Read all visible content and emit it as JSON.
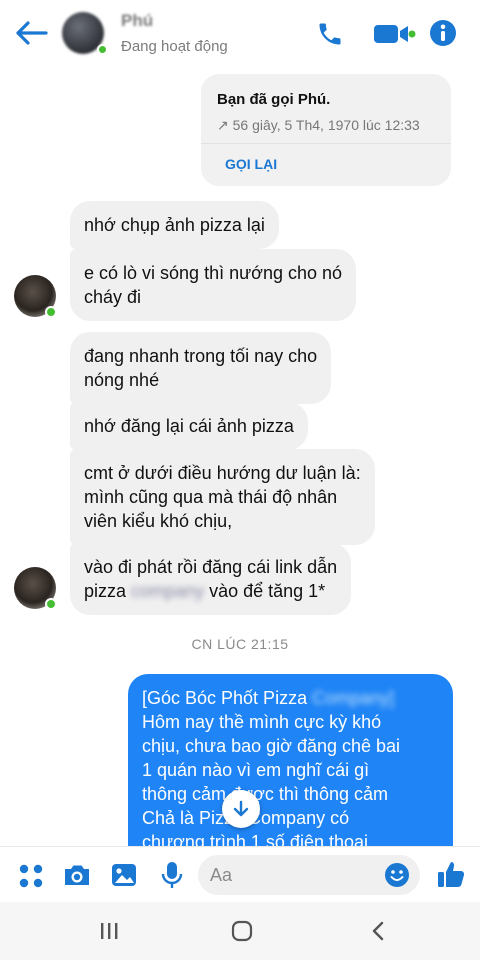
{
  "header": {
    "contact_name": "Phú",
    "status": "Đang hoạt động",
    "colors": {
      "accent": "#1a77d2",
      "online": "#44bd32"
    },
    "icons": [
      "back-arrow-icon",
      "phone-icon",
      "video-camera-icon",
      "info-icon"
    ]
  },
  "call_card": {
    "title": "Bạn đã gọi Phú.",
    "detail": "↗ 56 giây, 5 Th4, 1970 lúc 12:33",
    "action": "GỌI LẠI"
  },
  "messages": {
    "m1": "nhớ chụp ảnh pizza lại",
    "m2_l1": "e có lò vi sóng thì nướng cho nó",
    "m2_l2": "cháy đi",
    "m3_l1": "đang nhanh trong tối nay cho",
    "m3_l2": "nóng nhé",
    "m4": "nhớ đăng lại cái ảnh pizza",
    "m5_l1": "cmt ở dưới điều hướng dư luận là:",
    "m5_l2": "mình cũng qua mà thái độ nhân",
    "m5_l3": "viên kiểu khó chịu,",
    "m6_l1": "vào đi phát rồi đăng cái link dẫn",
    "m6_l2a": "pizza ",
    "m6_blur": "company",
    "m6_l2b": " vào để tăng 1*"
  },
  "timestamp": "CN LÚC 21:15",
  "outgoing": {
    "l1a": "[Góc Bóc Phốt Pizza ",
    "l1_blur": "Company]",
    "l2": "Hôm nay thề mình cực kỳ khó",
    "l3": "chịu, chưa bao giờ đăng chê bai",
    "l4": "1 quán nào vì em nghĩ cái gì",
    "l5": "thông cảm được thì thông cảm",
    "l6": "Chả là Pizza Company có",
    "l7": "chương trình 1 số điện thoại",
    "color": "#1f84f5"
  },
  "composer": {
    "placeholder": "Aa",
    "icons": [
      "apps-icon",
      "camera-icon",
      "gallery-icon",
      "microphone-icon",
      "emoji-icon",
      "thumbs-up-icon"
    ]
  },
  "navbar": {
    "icons": [
      "recent-apps-icon",
      "home-icon",
      "back-icon"
    ]
  }
}
